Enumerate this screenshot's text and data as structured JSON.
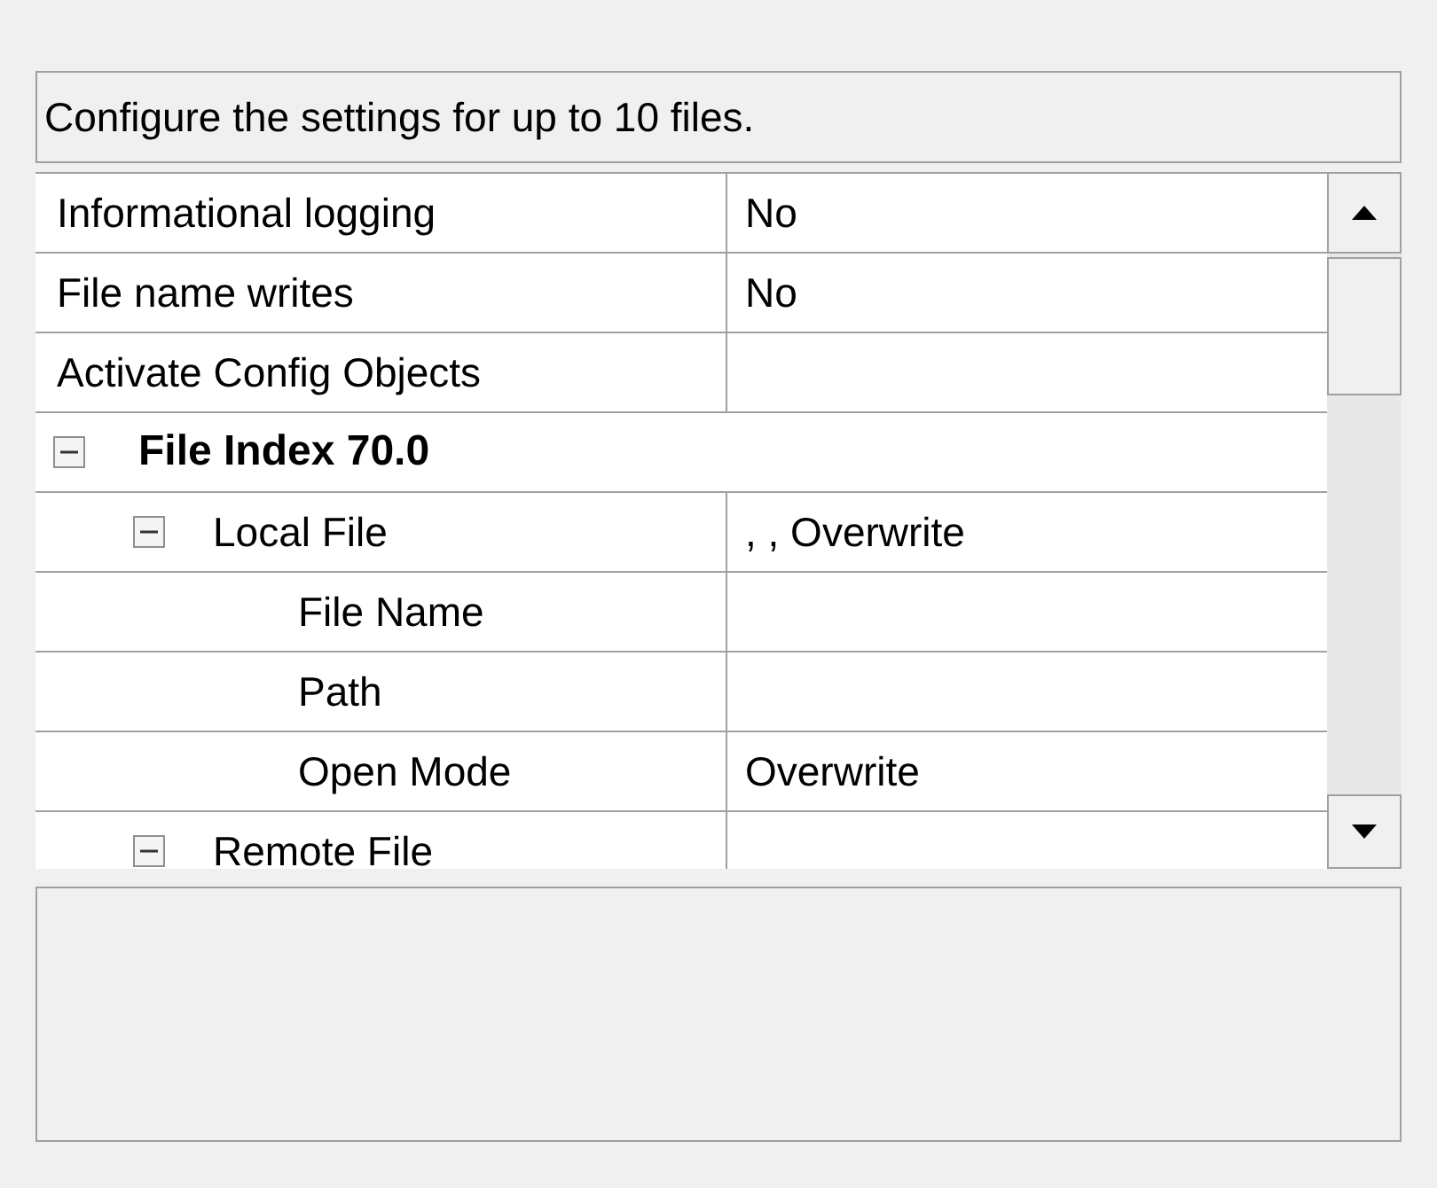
{
  "description": "Configure the settings for up to 10 files.",
  "grid": {
    "rows": [
      {
        "kind": "property",
        "label": "Informational logging",
        "value": "No"
      },
      {
        "kind": "property",
        "label": "File name writes",
        "value": "No"
      },
      {
        "kind": "property",
        "label": "Activate Config Objects"
      },
      {
        "kind": "category",
        "label": "File Index 70.0",
        "expanded": true,
        "children": [
          {
            "kind": "group",
            "label": "Local File",
            "value": ", , Overwrite",
            "expanded": true,
            "children": [
              {
                "kind": "property",
                "label": "File Name"
              },
              {
                "kind": "property",
                "label": "Path"
              },
              {
                "kind": "property",
                "label": "Open Mode",
                "value": "Overwrite"
              }
            ]
          },
          {
            "kind": "group",
            "label": "Remote File",
            "expanded": true
          }
        ]
      }
    ]
  }
}
